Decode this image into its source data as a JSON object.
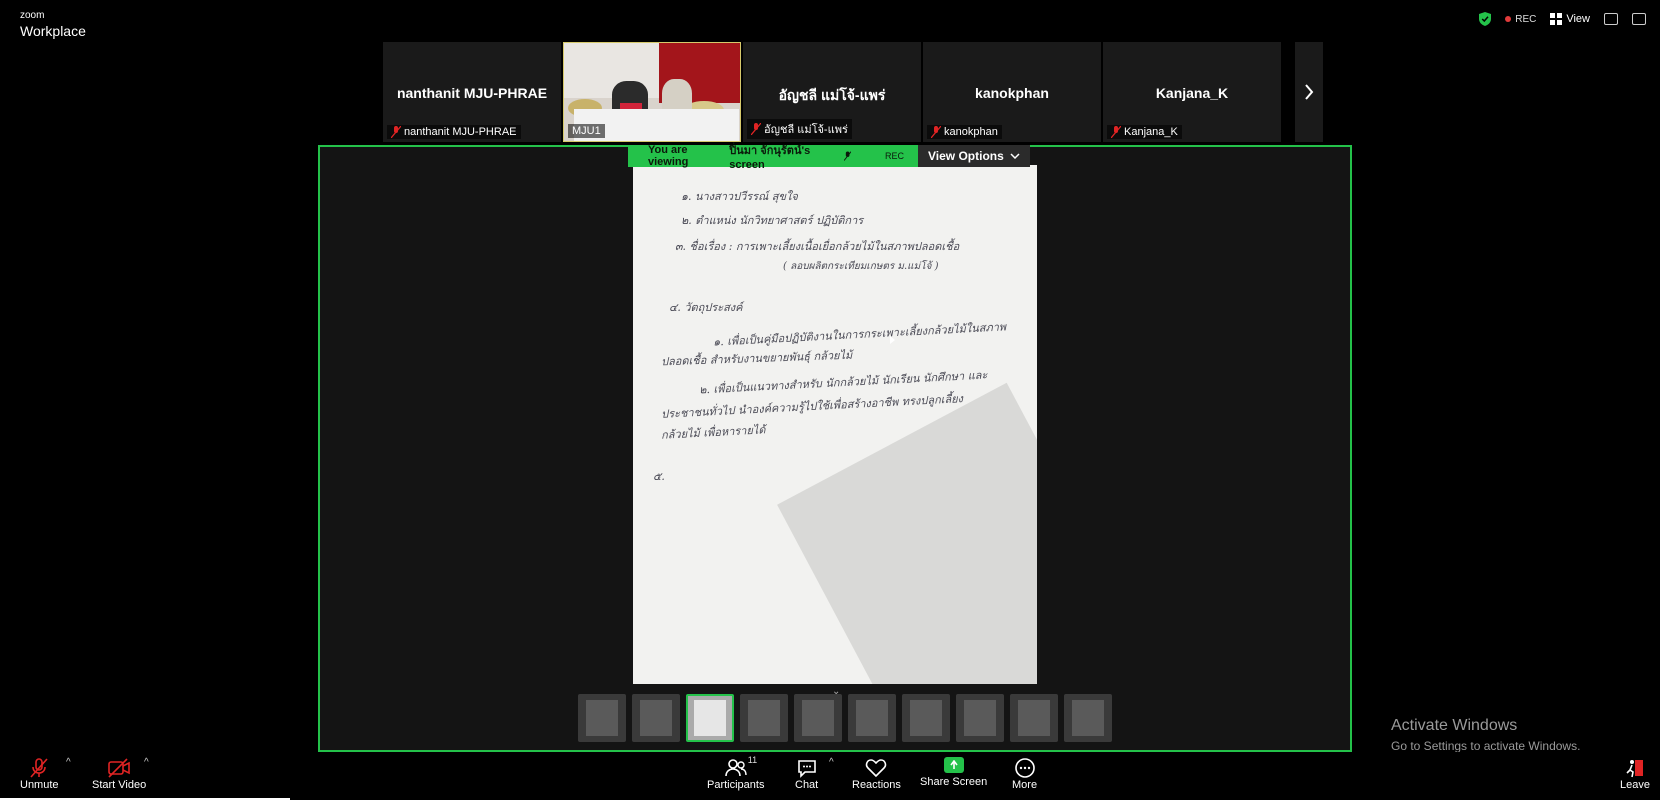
{
  "app": {
    "logo_top": "zoom",
    "logo_bottom": "Workplace"
  },
  "topbar": {
    "rec": "REC",
    "view": "View"
  },
  "participants": [
    {
      "display": "nanthanit MJU-PHRAE",
      "label": "nanthanit MJU-PHRAE",
      "muted": true,
      "video": false
    },
    {
      "display": "",
      "label": "MJU1",
      "muted": false,
      "video": true
    },
    {
      "display": "อัญชลี แม่โจ้-แพร่",
      "label": "อัญชลี แม่โจ้-แพร่",
      "muted": true,
      "video": false
    },
    {
      "display": "kanokphan",
      "label": "kanokphan",
      "muted": true,
      "video": false
    },
    {
      "display": "Kanjana_K",
      "label": "Kanjana_K",
      "muted": true,
      "video": false
    }
  ],
  "share": {
    "prefix": "You are viewing",
    "owner": "ปิ่นมา จักนุรัตน์'s screen",
    "rec": "REC",
    "view_options": "View Options"
  },
  "document": {
    "lines": [
      "๑. นางสาวปวีรรณ์ สุขใจ",
      "๒. ตำแหน่ง นักวิทยาศาสตร์ ปฏิบัติการ",
      "๓. ชื่อเรื่อง : การเพาะเลี้ยงเนื้อเยื่อกล้วยไม้ในสภาพปลอดเชื้อ",
      "( ลอบผลิตกระเทียมเกษตร ม.แม่โจ้ )",
      "๔. วัตถุประสงค์",
      "๑. เพื่อเป็นคู่มือปฏิบัติงานในการกระเพาะเลี้ยงกล้วยไม้ในสภาพ",
      "ปลอดเชื้อ สำหรับงานขยายพันธุ์ กล้วยไม้",
      "๒. เพื่อเป็นแนวทางสำหรับ นักกล้วยไม้ นักเรียน นักศึกษา และ",
      "ประชาชนทั่วไป นำองค์ความรู้ไปใช้เพื่อสร้างอาชีพ ทรงปลูกเลี้ยง",
      "กล้วยไม้ เพื่อหารายได้",
      "๕."
    ]
  },
  "activate_windows": {
    "title": "Activate Windows",
    "subtitle": "Go to Settings to activate Windows."
  },
  "toolbar": {
    "unmute": "Unmute",
    "start_video": "Start Video",
    "participants": "Participants",
    "participants_count": "11",
    "chat": "Chat",
    "reactions": "Reactions",
    "share_screen": "Share Screen",
    "more": "More",
    "leave": "Leave"
  },
  "colors": {
    "accent_green": "#24c24a",
    "rec_red": "#e23b3b",
    "leave_red": "#e02424"
  }
}
